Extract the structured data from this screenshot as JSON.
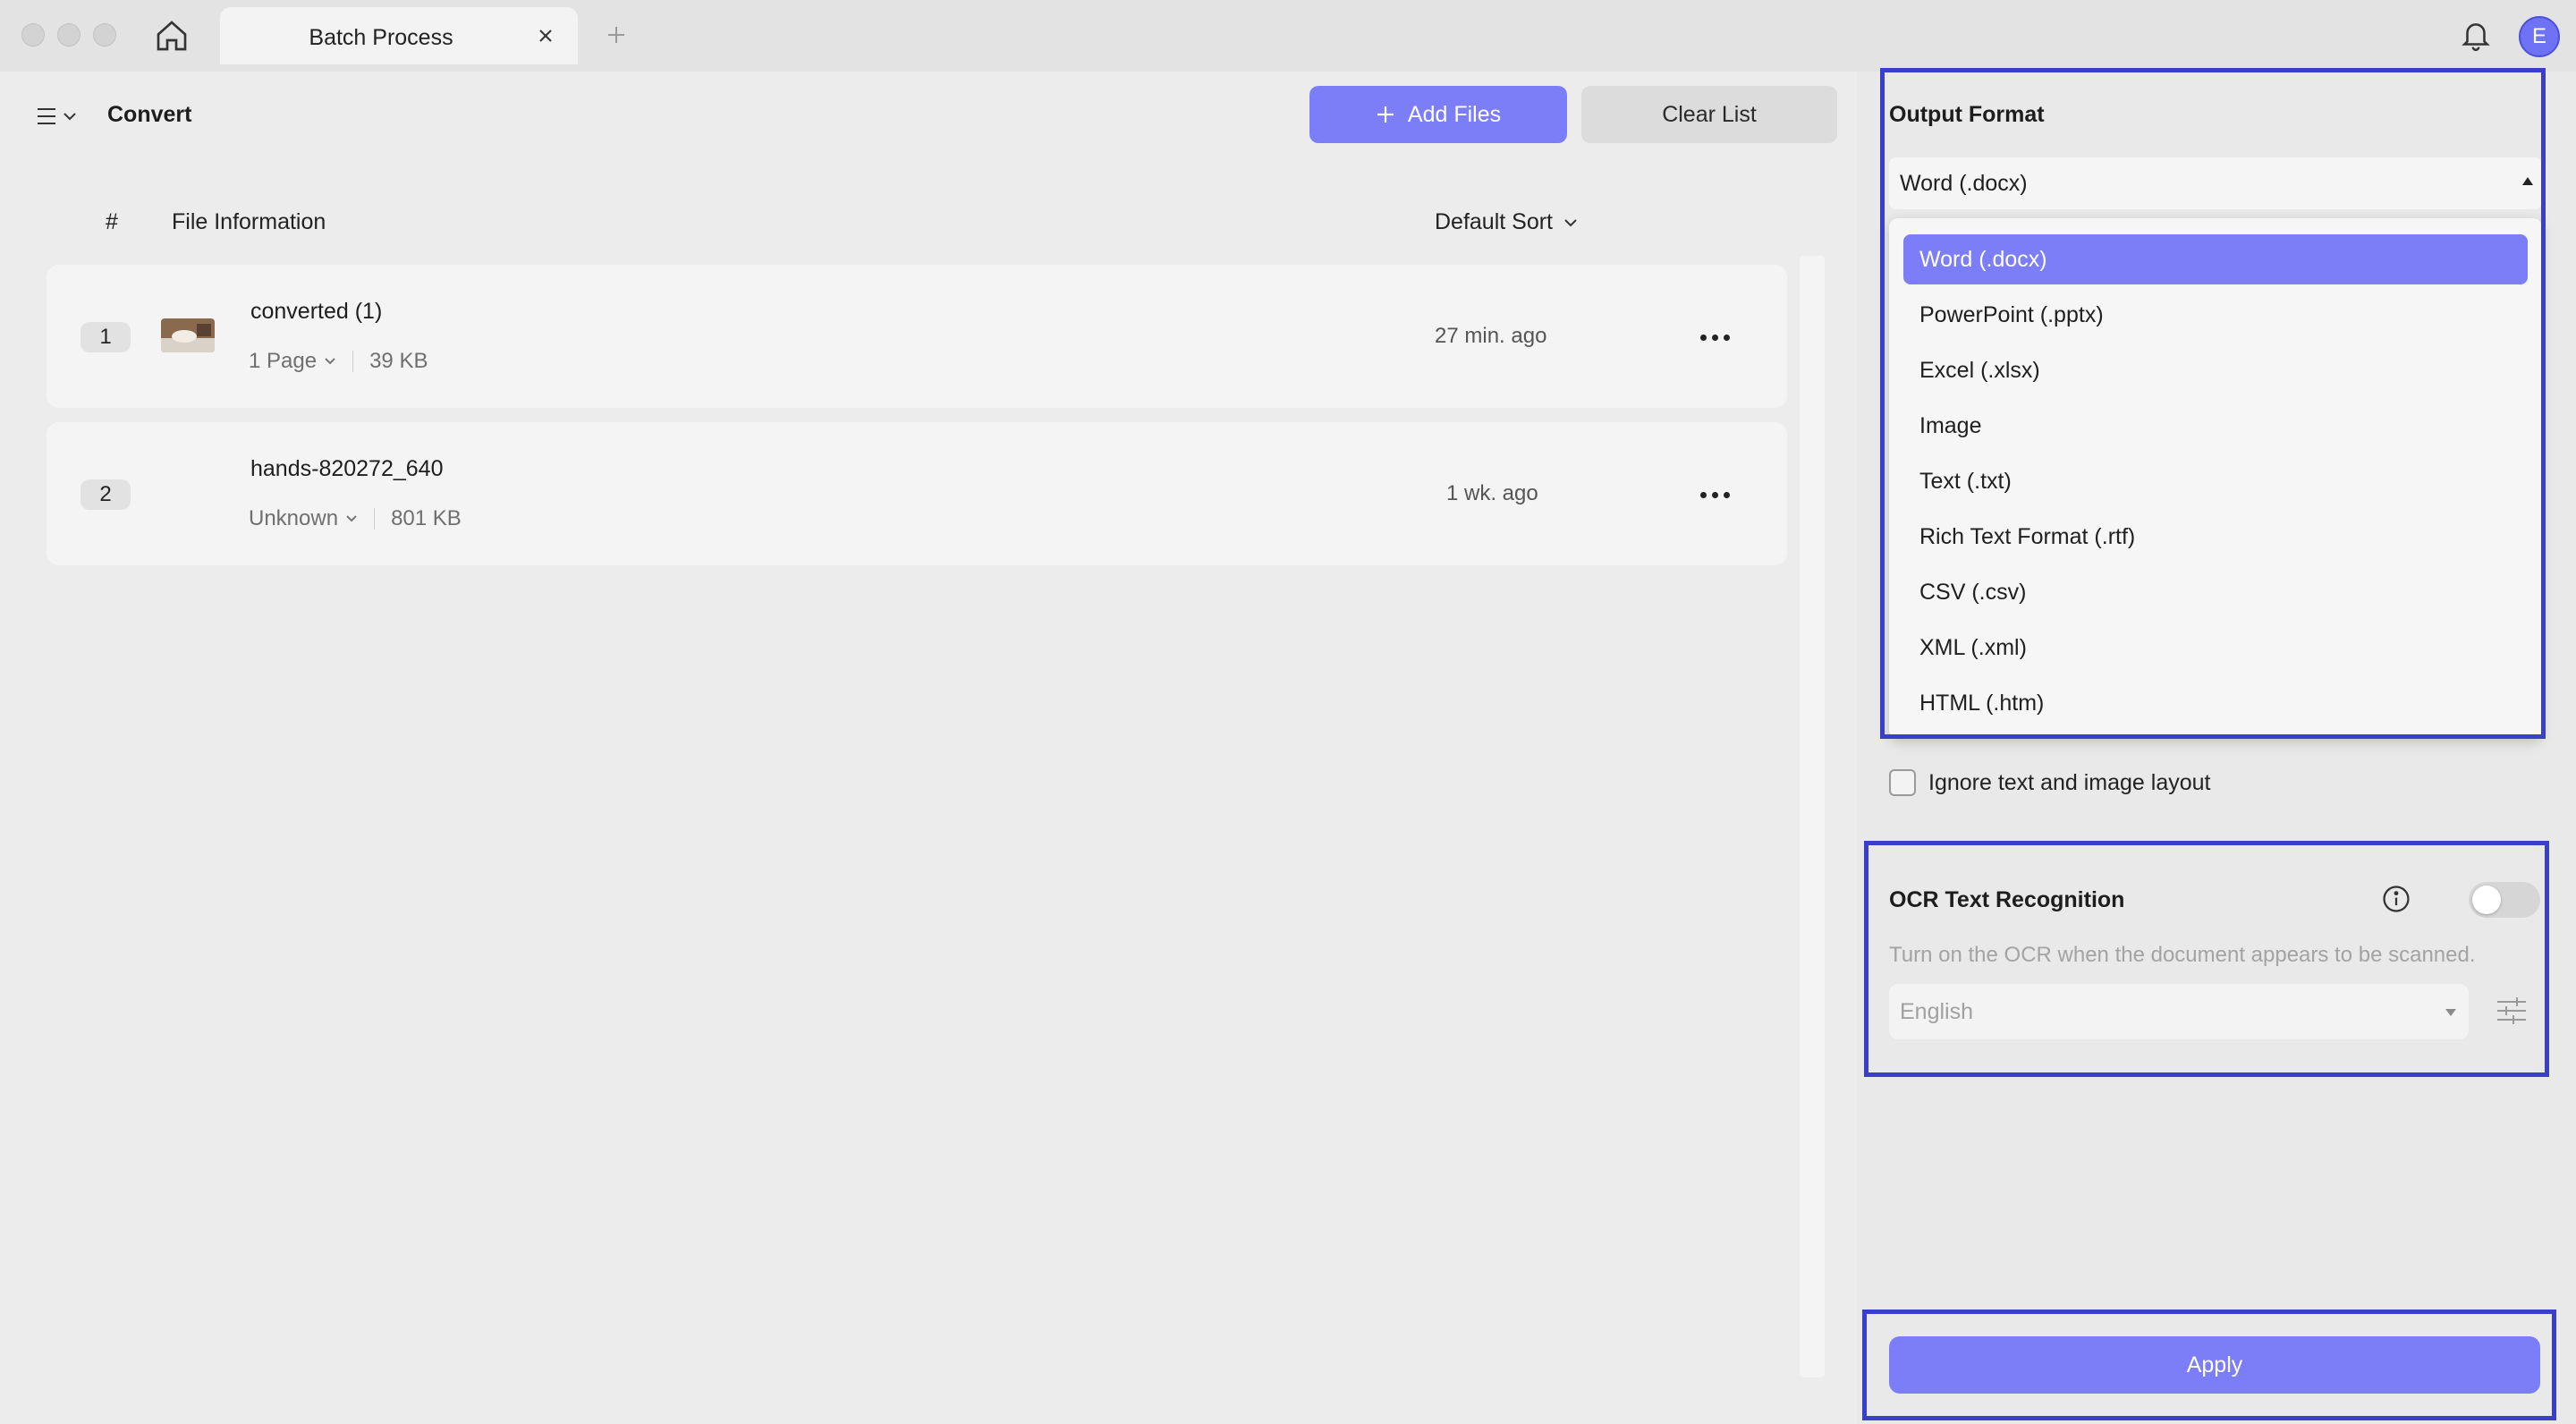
{
  "window": {
    "tab_title": "Batch Process",
    "avatar_initial": "E"
  },
  "toolbar": {
    "page_label": "Convert",
    "add_files_label": "Add Files",
    "clear_list_label": "Clear List"
  },
  "file_list": {
    "col_index": "#",
    "col_info": "File Information",
    "sort_label": "Default Sort",
    "rows": [
      {
        "index": "1",
        "name": "converted (1)",
        "pages": "1 Page",
        "size": "39 KB",
        "time": "27 min. ago",
        "has_thumbnail": true
      },
      {
        "index": "2",
        "name": "hands-820272_640",
        "pages": "Unknown",
        "size": "801 KB",
        "time": "1 wk. ago",
        "has_thumbnail": false
      }
    ]
  },
  "output_format": {
    "title": "Output Format",
    "selected": "Word (.docx)",
    "options": [
      "Word (.docx)",
      "PowerPoint (.pptx)",
      "Excel (.xlsx)",
      "Image",
      "Text (.txt)",
      "Rich Text Format (.rtf)",
      "CSV (.csv)",
      "XML (.xml)",
      "HTML (.htm)"
    ]
  },
  "layout_option": {
    "label": "Ignore text and image layout",
    "checked": false
  },
  "ocr": {
    "title": "OCR Text Recognition",
    "enabled": false,
    "description": "Turn on the OCR when the document appears to be scanned.",
    "language": "English"
  },
  "apply_label": "Apply",
  "colors": {
    "accent": "#7b7ef6",
    "highlight_border": "#3a3fc9"
  }
}
